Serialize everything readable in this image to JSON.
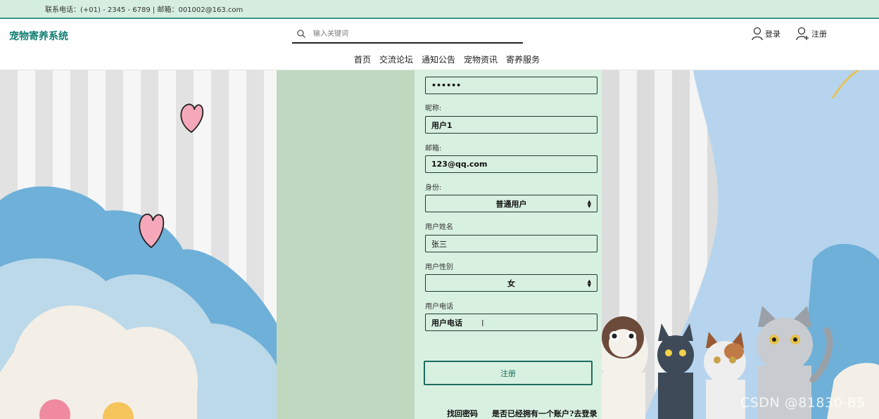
{
  "topbar": {
    "contact": "联系电话：(+01) - 2345 - 6789 | 邮箱：001002@163.com"
  },
  "header": {
    "logo": "宠物寄养系统",
    "search": {
      "placeholder": "输入关键词",
      "value": ""
    },
    "login_label": "登录",
    "register_label": "注册",
    "nav": [
      "首页",
      "交流论坛",
      "通知公告",
      "宠物资讯",
      "寄养服务"
    ]
  },
  "form": {
    "password_value": "••••••",
    "nickname": {
      "label": "昵称:",
      "value": "用户1"
    },
    "email": {
      "label": "邮箱:",
      "value": "123@qq.com"
    },
    "role": {
      "label": "身份:",
      "value": "普通用户"
    },
    "name": {
      "label": "用户姓名",
      "value": "张三"
    },
    "gender": {
      "label": "用户性别",
      "value": "女"
    },
    "phone": {
      "label": "用户电话",
      "value": "用户电话"
    },
    "submit_label": "注册",
    "forgot_label": "找回密码",
    "login_link": "是否已经拥有一个账户?去登录"
  },
  "watermark": "CSDN @81830-BS",
  "colors": {
    "brand": "#0e7d71",
    "panel": "#d8f0e0",
    "green_column": "#bfd8bf",
    "topbar": "#d6eee0"
  }
}
